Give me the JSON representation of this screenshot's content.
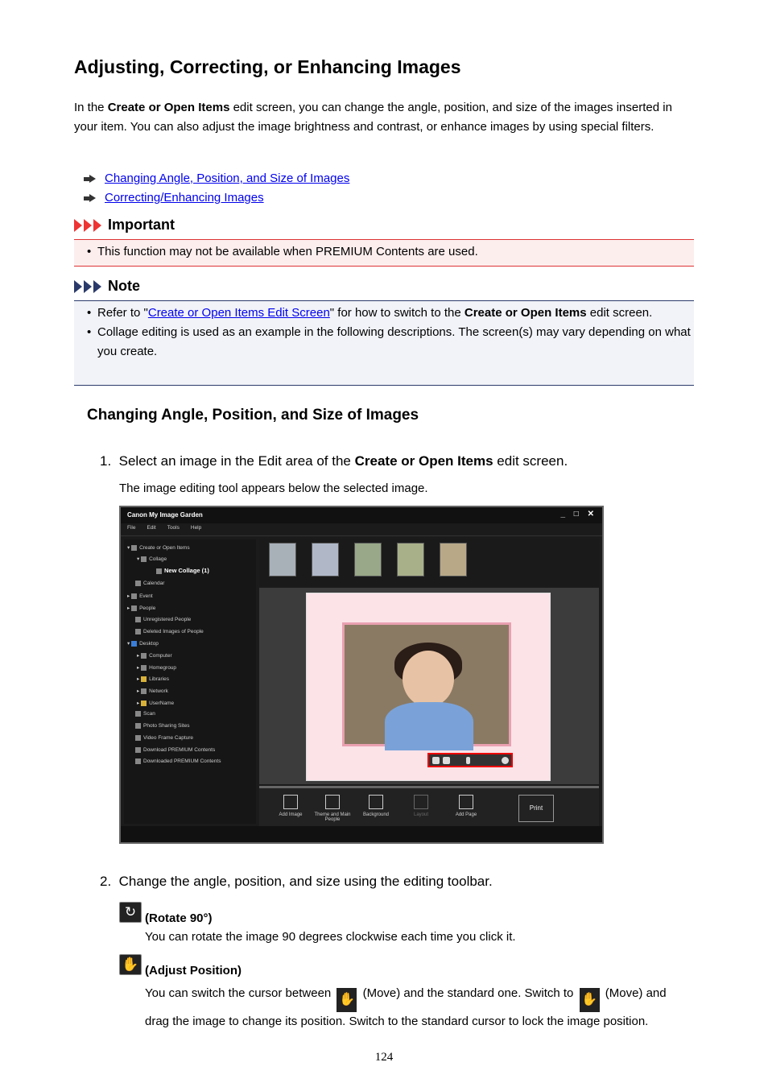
{
  "page_title": "Adjusting, Correcting, or Enhancing Images",
  "intro": {
    "p1": "In the ",
    "b1": "Create or Open Items",
    "p2": " edit screen, you can change the angle, position, and size of the images inserted in your item. You can also adjust the image brightness and contrast, or enhance images by using special filters."
  },
  "links": [
    "Changing Angle, Position, and Size of Images",
    "Correcting/Enhancing Images"
  ],
  "important": {
    "title": "Important",
    "items": [
      "This function may not be available when PREMIUM Contents are used."
    ]
  },
  "note": {
    "title": "Note",
    "item1_pre": "Refer to \"",
    "item1_link": "Create or Open Items Edit Screen",
    "item1_mid": "\" for how to switch to the ",
    "item1_bold": "Create or Open Items",
    "item1_post": " edit screen.",
    "item2": "Collage editing is used as an example in the following descriptions. The screen(s) may vary depending on what you create."
  },
  "section_title": "Changing Angle, Position, and Size of Images",
  "step1": {
    "num": "1.",
    "pre": "Select an image in the Edit area of the ",
    "bold": "Create or Open Items",
    "post": " edit screen.",
    "sub": "The image editing tool appears below the selected image."
  },
  "screenshot": {
    "window_title": "Canon My Image Garden",
    "window_buttons": "_ □ ✕",
    "menu": [
      "File",
      "Edit",
      "Tools",
      "Help"
    ],
    "tree": [
      "Create or Open Items",
      "Collage",
      "New Collage (1)",
      "Calendar",
      "Event",
      "People",
      "Unregistered People",
      "Deleted Images of People",
      "Desktop",
      "Computer",
      "Homegroup",
      "Libraries",
      "Network",
      "UserName",
      "Scan",
      "Photo Sharing Sites",
      "Video Frame Capture",
      "Download PREMIUM Contents",
      "Downloaded PREMIUM Contents"
    ],
    "tools": [
      "Add Image",
      "Theme and Main People",
      "Background",
      "Layout",
      "Add Page"
    ],
    "print_label": "Print"
  },
  "step2": {
    "num": "2.",
    "text": "Change the angle, position, and size using the editing toolbar."
  },
  "rotate": {
    "icon": "rotate-icon",
    "label": "(Rotate 90°)",
    "desc": "You can rotate the image 90 degrees clockwise each time you click it."
  },
  "adjust": {
    "icon": "hand-icon",
    "label": "(Adjust Position)",
    "d1": "You can switch the cursor between ",
    "d2": " (Move) and the standard one. Switch to ",
    "d3": " (Move) and",
    "d4": "drag the image to change its position. Switch to the standard cursor to lock the image position."
  },
  "page_number": "124"
}
